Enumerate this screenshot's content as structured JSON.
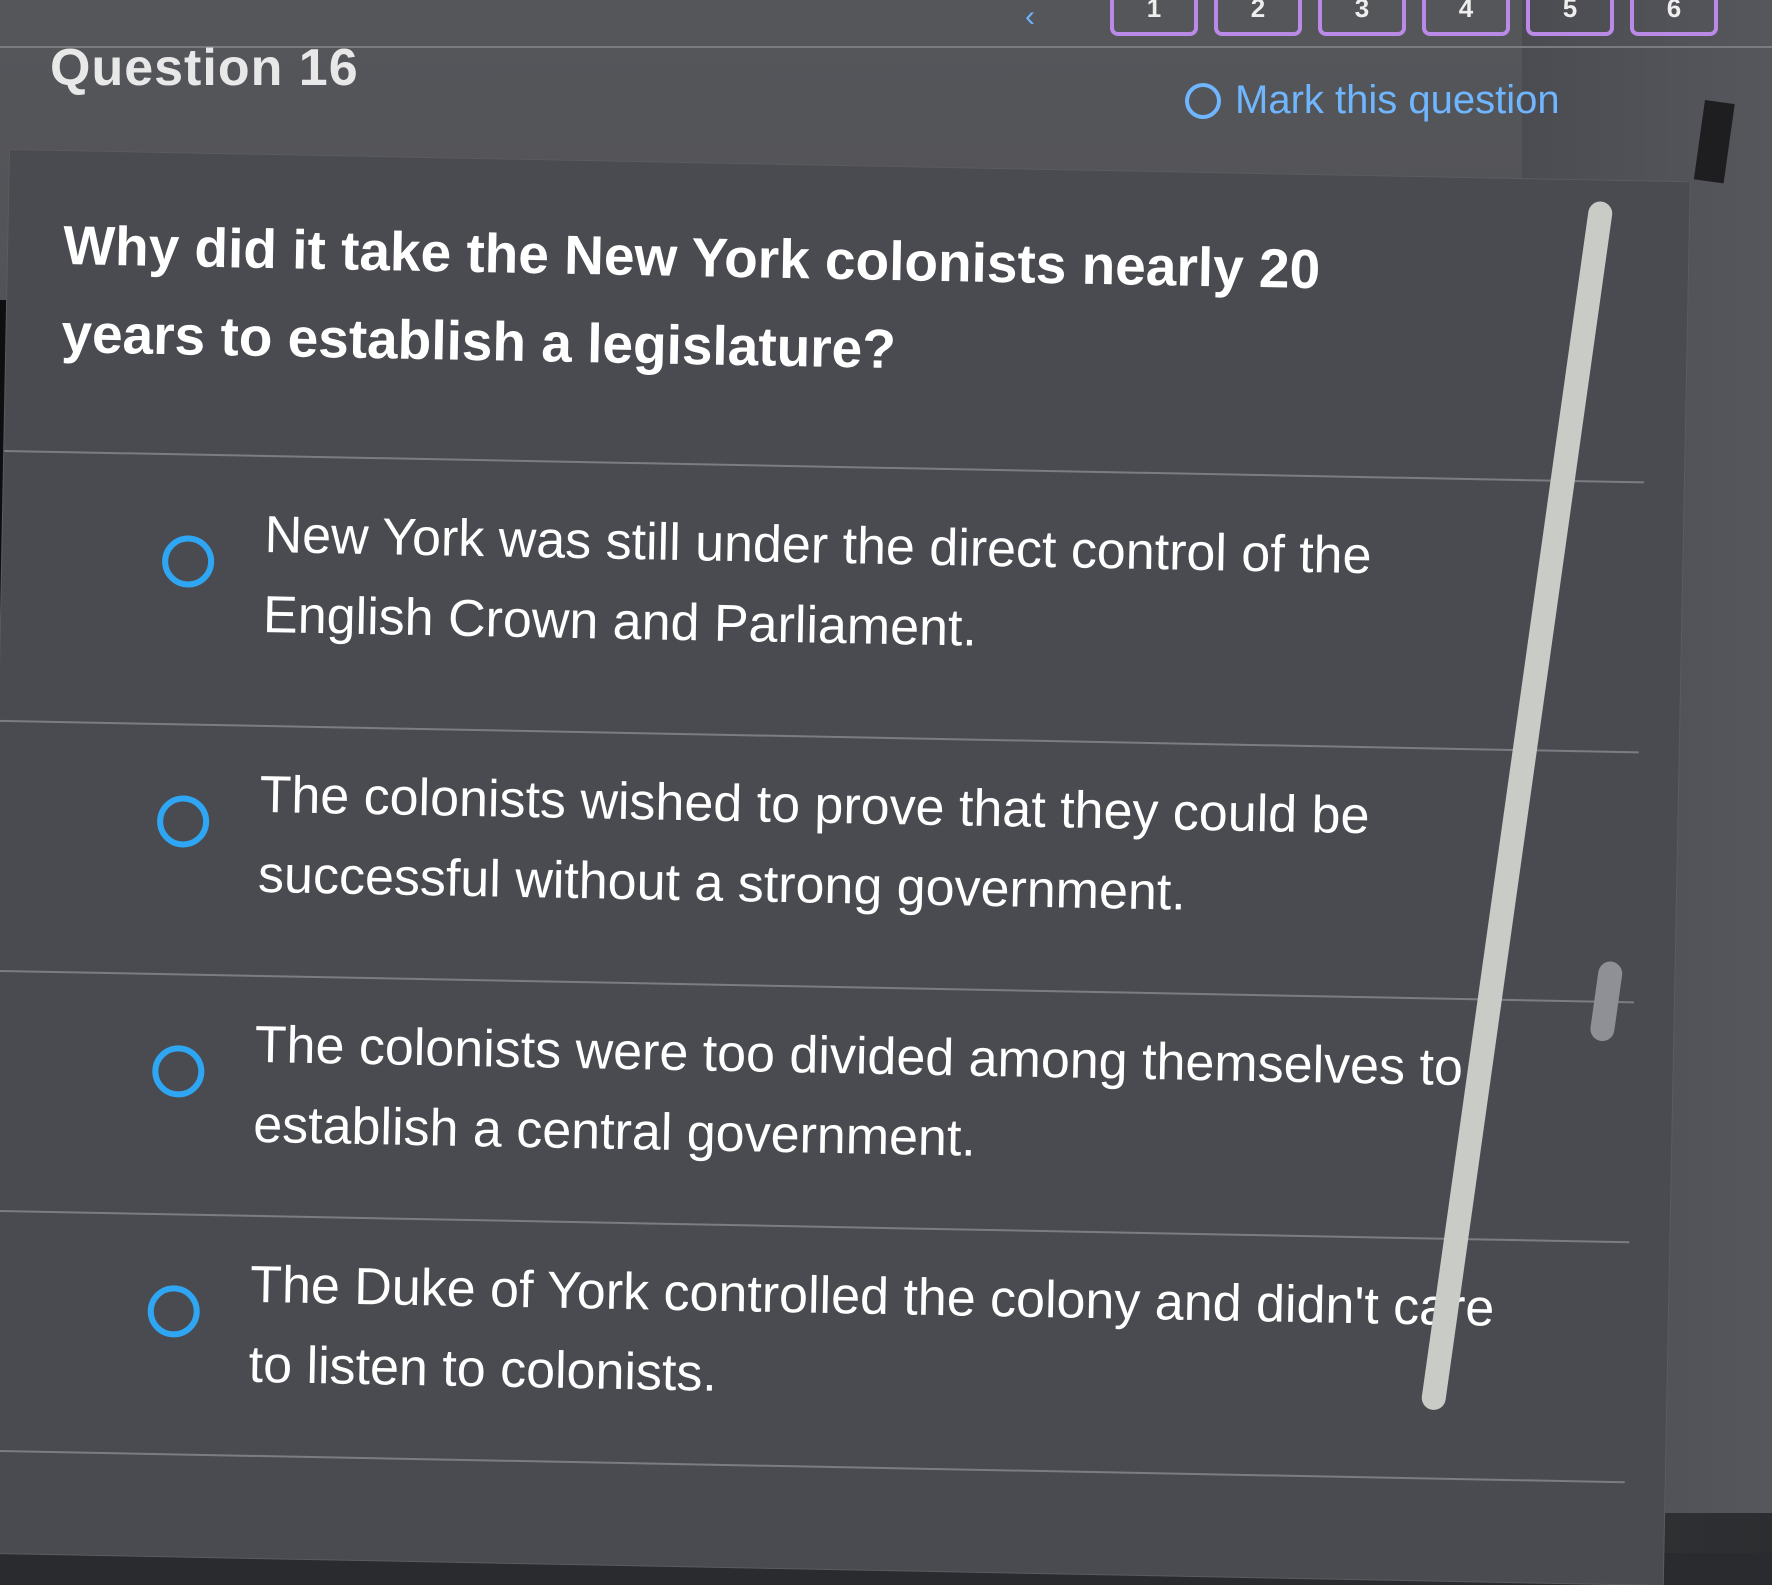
{
  "header": {
    "question_label": "Question 16",
    "mark_label": "Mark this question",
    "nav_numbers": [
      "1",
      "2",
      "3",
      "4",
      "5",
      "6"
    ]
  },
  "question": {
    "prompt": "Why did it take the New York colonists nearly 20 years to establish a legislature?"
  },
  "choices": [
    {
      "text": "New York was still under the direct control of the English Crown and Parliament."
    },
    {
      "text": "The colonists wished to prove that they could be successful without a strong government."
    },
    {
      "text": "The colonists were too divided among themselves to establish a central government."
    },
    {
      "text": "The Duke of York controlled the colony and didn't care to listen to colonists."
    }
  ],
  "colors": {
    "radio": "#2fa6f3",
    "nav_border": "#b98ae6",
    "mark_text": "#6fb6ff",
    "background": "#4a4b50"
  }
}
